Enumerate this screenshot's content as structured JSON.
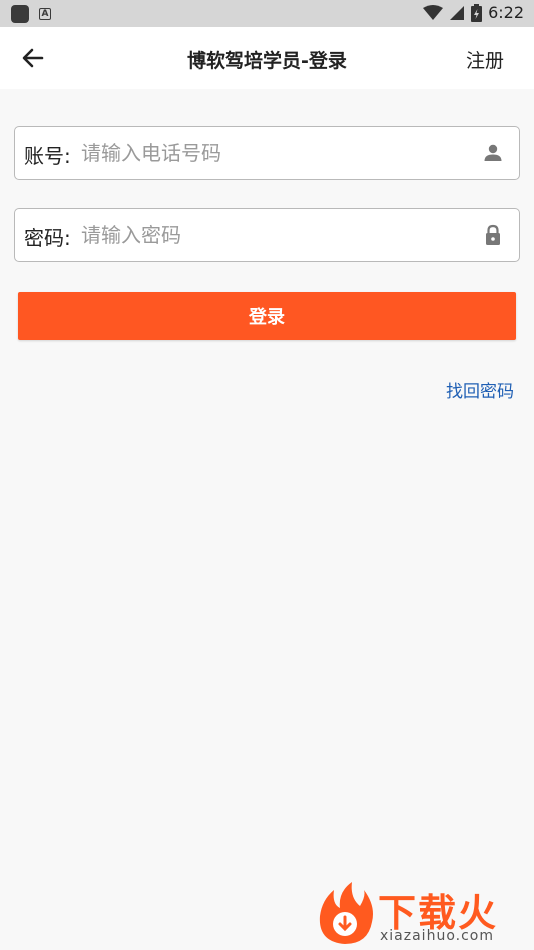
{
  "status_bar": {
    "time": "6:22",
    "notification_icon_letter": "A"
  },
  "header": {
    "title": "博软驾培学员-登录",
    "register_label": "注册",
    "back_icon": "arrow-left-icon"
  },
  "form": {
    "account": {
      "label": "账号:",
      "placeholder": "请输入电话号码",
      "value": "",
      "icon": "person-icon"
    },
    "password": {
      "label": "密码:",
      "placeholder": "请输入密码",
      "value": "",
      "icon": "lock-icon"
    },
    "login_label": "登录",
    "forgot_label": "找回密码"
  },
  "watermark": {
    "brand": "下载火",
    "domain": "xiazaihuo.com"
  },
  "colors": {
    "accent": "#ff5722",
    "link": "#1f5fb4",
    "background": "#f8f8f8",
    "header_bg": "#ffffff",
    "status_bar": "#d6d6d6"
  }
}
